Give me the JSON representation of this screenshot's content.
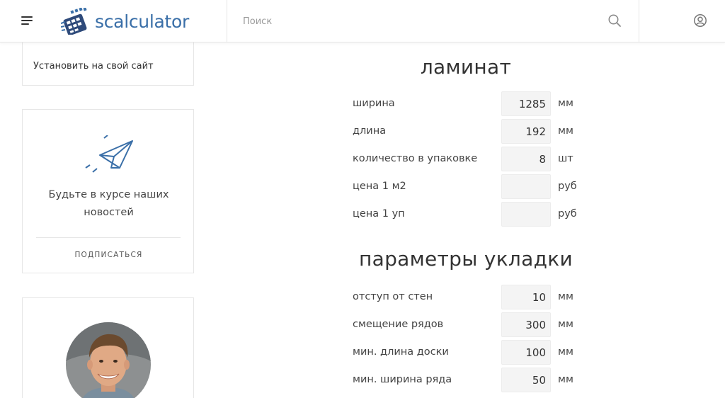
{
  "header": {
    "logo_text": "scalculator",
    "search_placeholder": "Поиск",
    "brand_color": "#3a6fa8",
    "icons": [
      "hamburger-menu-icon",
      "search-icon",
      "user-icon"
    ]
  },
  "sidebar": {
    "install_link": "Установить на свой сайт",
    "news": {
      "line1": "Будьте в курсе наших",
      "line2": "новостей",
      "subscribe_label": "ПОДПИСАТЬСЯ",
      "icon": "paper-plane-icon"
    },
    "avatar": "avatar-photo"
  },
  "laminate": {
    "title": "ламинат",
    "rows": [
      {
        "label": "ширина",
        "value": "1285",
        "unit": "мм"
      },
      {
        "label": "длина",
        "value": "192",
        "unit": "мм"
      },
      {
        "label": "количество в упаковке",
        "value": "8",
        "unit": "шт"
      },
      {
        "label": "цена 1 м2",
        "value": "",
        "unit": "руб"
      },
      {
        "label": "цена 1 уп",
        "value": "",
        "unit": "руб"
      }
    ]
  },
  "layout_params": {
    "title": "параметры укладки",
    "rows": [
      {
        "label": "отступ от стен",
        "value": "10",
        "unit": "мм"
      },
      {
        "label": "смещение рядов",
        "value": "300",
        "unit": "мм"
      },
      {
        "label": "мин. длина доски",
        "value": "100",
        "unit": "мм"
      },
      {
        "label": "мин. ширина ряда",
        "value": "50",
        "unit": "мм"
      }
    ]
  }
}
